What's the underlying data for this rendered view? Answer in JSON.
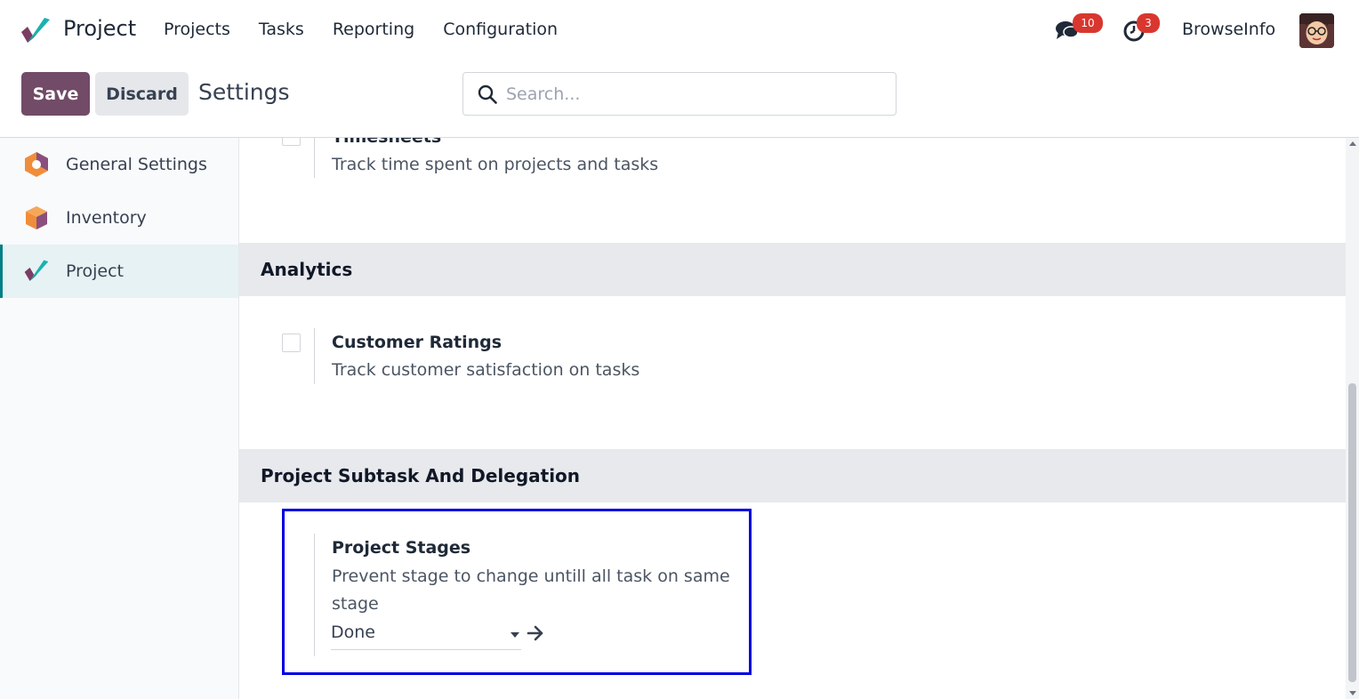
{
  "navbar": {
    "app_name": "Project",
    "menu": [
      "Projects",
      "Tasks",
      "Reporting",
      "Configuration"
    ],
    "messages_count": "10",
    "activities_count": "3",
    "company": "BrowseInfo"
  },
  "control_panel": {
    "save_label": "Save",
    "discard_label": "Discard",
    "breadcrumb": "Settings",
    "search_placeholder": "Search..."
  },
  "sidebar": {
    "items": [
      {
        "label": "General Settings",
        "icon": "general-settings-icon",
        "active": false
      },
      {
        "label": "Inventory",
        "icon": "inventory-icon",
        "active": false
      },
      {
        "label": "Project",
        "icon": "project-icon",
        "active": true
      }
    ]
  },
  "content": {
    "timesheets": {
      "title": "Timesheets",
      "description": "Track time spent on projects and tasks",
      "checked": false
    },
    "analytics": {
      "header": "Analytics",
      "customer_ratings": {
        "title": "Customer Ratings",
        "description": "Track customer satisfaction on tasks",
        "checked": false
      }
    },
    "subtask_delegation": {
      "header": "Project Subtask And Delegation",
      "project_stages": {
        "title": "Project Stages",
        "description": "Prevent stage to change untill all task on same stage",
        "selected_stage": "Done"
      }
    }
  },
  "colors": {
    "primary": "#714B67",
    "highlight": "#0000e0",
    "badge": "#d9362f",
    "active_accent": "#017e84"
  }
}
